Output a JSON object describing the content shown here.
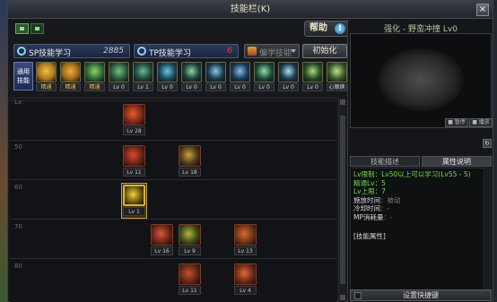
{
  "window": {
    "title": "技能栏(K)",
    "close_glyph": "×"
  },
  "help": {
    "label": "帮助",
    "icon_glyph": "!"
  },
  "points": {
    "sp_label": "SP技能学习",
    "sp_value": "2885",
    "tp_label": "TP技能学习",
    "tp_value": "6"
  },
  "filter": {
    "label": "偏学技能"
  },
  "init_label": "初始化",
  "general_skill_label": "通用技能",
  "skillbar": [
    {
      "label": "精通",
      "color": "#b07a20",
      "accent": "#f0c040",
      "gold": true
    },
    {
      "label": "精通",
      "color": "#a06a18",
      "accent": "#e8b040",
      "gold": true
    },
    {
      "label": "精通",
      "color": "#2a6a3a",
      "accent": "#9ad060",
      "gold": true
    },
    {
      "label": "Lv 0",
      "color": "#2a5a3a",
      "accent": "#7ac080",
      "gold": false
    },
    {
      "label": "Lv 1",
      "color": "#1f4a3a",
      "accent": "#6aba9a",
      "gold": false
    },
    {
      "label": "Lv 0",
      "color": "#1a4a5a",
      "accent": "#6acada",
      "gold": false
    },
    {
      "label": "Lv 0",
      "color": "#1f3f3a",
      "accent": "#8ada9a",
      "gold": false
    },
    {
      "label": "Lv 0",
      "color": "#1a3a4a",
      "accent": "#8acaea",
      "gold": false
    },
    {
      "label": "Lv 0",
      "color": "#1a3a5a",
      "accent": "#8abaea",
      "gold": false
    },
    {
      "label": "Lv 0",
      "color": "#1a4a3a",
      "accent": "#9ae0aa",
      "gold": false
    },
    {
      "label": "Lv 0",
      "color": "#1a3a4a",
      "accent": "#aae0f0",
      "gold": false
    },
    {
      "label": "Lv 0",
      "color": "#2a4a2a",
      "accent": "#aada7a",
      "gold": false
    },
    {
      "label": "心眼换",
      "color": "#3a5a2a",
      "accent": "#c8e08a",
      "gold": false
    }
  ],
  "tree_levels": [
    "Lv.",
    "50",
    "60",
    "70",
    "80"
  ],
  "tree_skills": [
    {
      "lv": "Lv 28",
      "color": "#7a2a18",
      "accent": "#e85a2a",
      "sel": false
    },
    {
      "lv": "Lv 11",
      "color": "#6a2418",
      "accent": "#d84a2a",
      "sel": false
    },
    {
      "lv": "Lv 18",
      "color": "#4a3a18",
      "accent": "#c8a040",
      "sel": false
    },
    {
      "lv": "Lv 1",
      "color": "#6a5a10",
      "accent": "#f0d040",
      "sel": true
    },
    {
      "lv": "Lv 16",
      "color": "#6a2418",
      "accent": "#d85a3a",
      "sel": false
    },
    {
      "lv": "Lv 9",
      "color": "#3a4a18",
      "accent": "#b8b040",
      "sel": false
    },
    {
      "lv": "Lv 13",
      "color": "#6a3418",
      "accent": "#e06a2a",
      "sel": false
    },
    {
      "lv": "Lv 11",
      "color": "#5a2a18",
      "accent": "#d04a2a",
      "sel": false
    },
    {
      "lv": "Lv 4",
      "color": "#6a2a18",
      "accent": "#e06a3a",
      "sel": false
    }
  ],
  "preview": {
    "title": "强化 - 野蛮冲撞 Lv0",
    "btn_a": "■ 暂停",
    "btn_b": "■ 播放"
  },
  "tabs": {
    "desc": "技能描述",
    "attr": "属性说明"
  },
  "info": {
    "lines": [
      {
        "k": "Lv限制",
        "v": "：Lv50以上可以学习(Lv55 - 5)",
        "muted": false
      },
      {
        "k": "精通Lv",
        "v": "：5",
        "muted": false
      },
      {
        "k": "Lv上限",
        "v": "：7",
        "muted": false
      },
      {
        "k": "施放时间",
        "v": "：被动",
        "muted": true
      },
      {
        "k": "冷却时间",
        "v": "：-",
        "muted": true
      },
      {
        "k": "MP消耗量",
        "v": "：-",
        "muted": true
      }
    ],
    "attr": "[技能属性]"
  },
  "keybind_label": "设置快捷键"
}
